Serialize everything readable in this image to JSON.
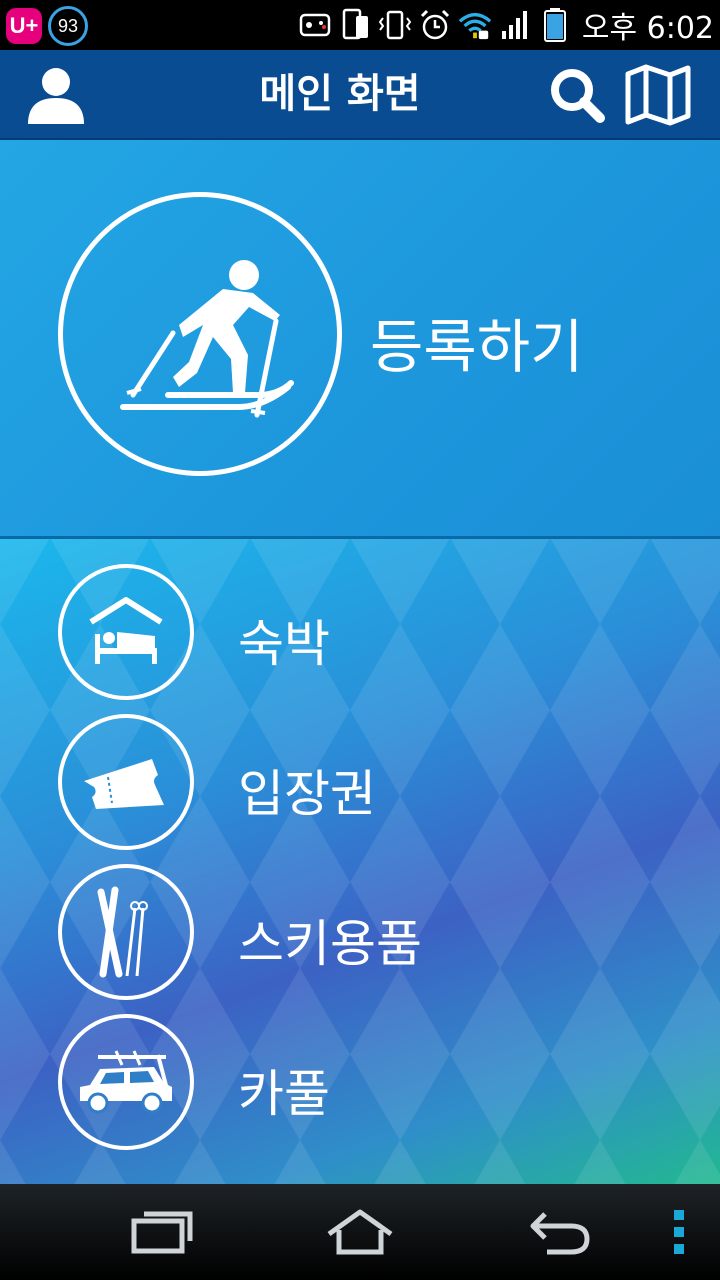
{
  "status_bar": {
    "carrier_badge": "U+",
    "battery_level": "93",
    "time": "오후 6:02",
    "icons": [
      "game-controller-icon",
      "phone-icon",
      "vibrate-icon",
      "alarm-icon",
      "wifi-icon",
      "signal-icon",
      "battery-icon"
    ]
  },
  "app_bar": {
    "title": "메인 화면",
    "icons": [
      "profile-icon",
      "search-icon",
      "map-icon"
    ]
  },
  "register": {
    "label": "등록하기",
    "icon": "skier-icon"
  },
  "menu": {
    "items": [
      {
        "label": "숙박",
        "icon": "bed-icon"
      },
      {
        "label": "입장권",
        "icon": "ticket-icon"
      },
      {
        "label": "스키용품",
        "icon": "ski-equipment-icon"
      },
      {
        "label": "카풀",
        "icon": "car-icon"
      }
    ]
  },
  "nav_bar": {
    "icons": [
      "recent-apps-icon",
      "home-icon",
      "back-icon",
      "menu-icon"
    ]
  },
  "colors": {
    "app_bar": "#0a4c92",
    "register_panel": "#1d96dc",
    "nav_accent": "#1aa8d8"
  }
}
